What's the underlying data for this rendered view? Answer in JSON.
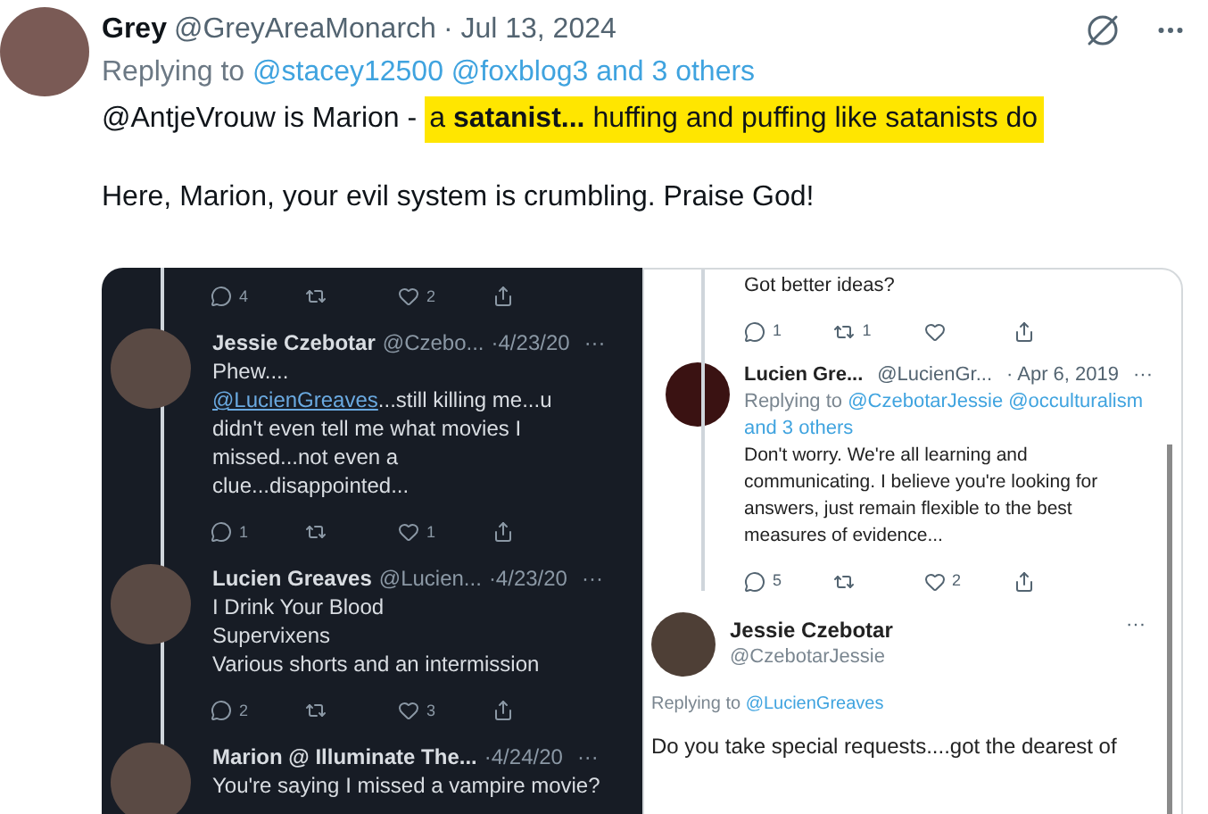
{
  "tweet": {
    "name": "Grey",
    "handle": "@GreyAreaMonarch",
    "separator": "·",
    "date": "Jul 13, 2024",
    "replying_prefix": "Replying to",
    "replying_links": "@stacey12500 @foxblog3 and 3 others",
    "body_plain": "@AntjeVrouw is Marion -",
    "body_highlight": "a **satanist...** huffing and puffing like satanists do",
    "paragraph_2": "Here, Marion, your evil system is crumbling. Praise God!"
  },
  "embedded_left": [
    {
      "kind": "actions",
      "actions": [
        {
          "kind": "reply",
          "count": "4"
        },
        {
          "kind": "retweet"
        },
        {
          "kind": "like",
          "count": "2"
        },
        {
          "kind": "share"
        }
      ]
    },
    {
      "kind": "tweet",
      "name": "Jessie Czebotar",
      "handle": "@Czebo...",
      "date": "·4/23/20",
      "more": "···",
      "lines": [
        {
          "text": "Phew...."
        },
        {
          "link": "@LucienGreaves",
          "text": "...still killing me...u"
        },
        {
          "text": "didn't even tell me what movies I"
        },
        {
          "text": "missed...not even a"
        },
        {
          "text": "clue...disappointed..."
        }
      ]
    },
    {
      "kind": "actions",
      "actions": [
        {
          "kind": "reply",
          "count": "1"
        },
        {
          "kind": "retweet"
        },
        {
          "kind": "like",
          "count": "1"
        },
        {
          "kind": "share"
        }
      ]
    },
    {
      "kind": "tweet",
      "name": "Lucien Greaves",
      "handle": "@Lucien...",
      "date": "·4/23/20",
      "more": "···",
      "lines": [
        {
          "text": "I Drink Your Blood"
        },
        {
          "text": "Supervixens"
        },
        {
          "text": "Various shorts and an intermission"
        }
      ]
    },
    {
      "kind": "actions",
      "actions": [
        {
          "kind": "reply",
          "count": "2"
        },
        {
          "kind": "retweet"
        },
        {
          "kind": "like",
          "count": "3"
        },
        {
          "kind": "share"
        }
      ]
    },
    {
      "kind": "tweet",
      "name": "Marion @ Illuminate The...",
      "date": "·4/24/20",
      "more": "···",
      "lines": [
        {
          "text": "You're saying I missed a vampire movie?"
        }
      ]
    }
  ],
  "embedded_right": [
    {
      "kind": "text",
      "text": "Got better ideas?"
    },
    {
      "kind": "actions",
      "actions": [
        {
          "kind": "reply",
          "count": "1"
        },
        {
          "kind": "retweet",
          "count": "1"
        },
        {
          "kind": "like"
        },
        {
          "kind": "share"
        }
      ]
    },
    {
      "kind": "tweet",
      "name": "Lucien Gre...",
      "handle": "@LucienGr...",
      "date": "· Apr 6, 2019",
      "more": "···",
      "replying_prefix": "Replying to",
      "replying_links": "@CzebotarJessie @occulturalism and 3 others",
      "lines": [
        {
          "text": "Don't worry. We're all learning and communicating. I believe you're looking for answers, just remain flexible to the best measures of evidence..."
        }
      ]
    },
    {
      "kind": "actions",
      "actions": [
        {
          "kind": "reply",
          "count": "5"
        },
        {
          "kind": "retweet"
        },
        {
          "kind": "like",
          "count": "2"
        },
        {
          "kind": "share"
        }
      ]
    },
    {
      "kind": "focus_tweet",
      "name": "Jessie Czebotar",
      "handle": "@CzebotarJessie",
      "more": "···",
      "replying_prefix": "Replying to",
      "replying_links": "@LucienGreaves",
      "lines": [
        {
          "text": "Do you take special requests....got the dearest of"
        }
      ]
    }
  ]
}
